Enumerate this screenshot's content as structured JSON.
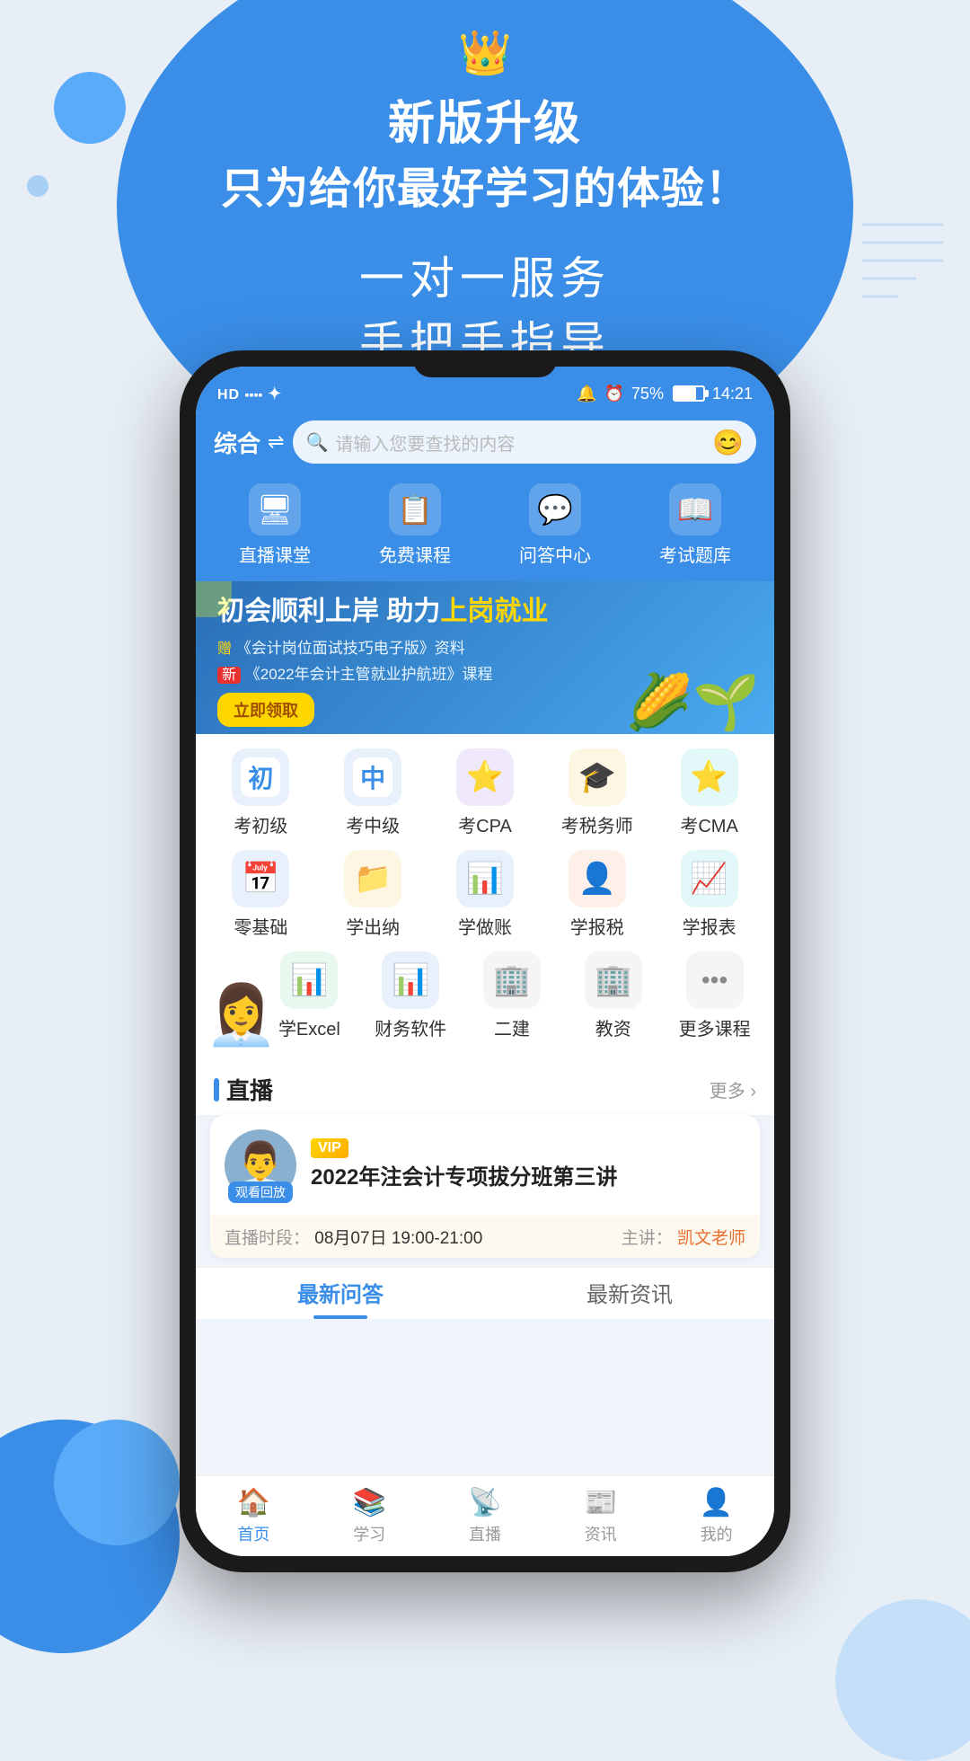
{
  "promo": {
    "crown": "👑",
    "title1": "新版升级",
    "title2": "只为给你最好学习的体验！",
    "subtitle1": "一对一服务",
    "subtitle2": "手把手指导"
  },
  "phone": {
    "status": {
      "left": "HD  ull  ✓",
      "battery_percent": "75%",
      "time": "14:21"
    },
    "header": {
      "category": "综合",
      "filter_icon": "☰",
      "search_placeholder": "请输入您要查找的内容",
      "emoji": "😊"
    },
    "quick_nav": [
      {
        "icon": "🖥",
        "label": "直播课堂"
      },
      {
        "icon": "📋",
        "label": "免费课程"
      },
      {
        "icon": "💬",
        "label": "问答中心"
      },
      {
        "icon": "📖",
        "label": "考试题库"
      }
    ],
    "banner": {
      "title": "初会顺利上岸 助力上岗就业",
      "highlight": "上岗就业",
      "sub1": "赠《会计岗位面试技巧电子版》资料",
      "sub2": "新《2022年会计主管就业护航班》课程",
      "btn": "立即领取"
    },
    "course_rows": [
      [
        {
          "icon": "🎒",
          "label": "考初级",
          "color": "ci-blue"
        },
        {
          "icon": "🎒",
          "label": "考中级",
          "color": "ci-blue"
        },
        {
          "icon": "⭐",
          "label": "考CPA",
          "color": "ci-purple"
        },
        {
          "icon": "🎓",
          "label": "考税务师",
          "color": "ci-yellow"
        },
        {
          "icon": "⭐",
          "label": "考CMA",
          "color": "ci-teal"
        }
      ],
      [
        {
          "icon": "📅",
          "label": "零基础",
          "color": "ci-blue"
        },
        {
          "icon": "📁",
          "label": "学出纳",
          "color": "ci-yellow"
        },
        {
          "icon": "📊",
          "label": "学做账",
          "color": "ci-blue"
        },
        {
          "icon": "👤",
          "label": "学报税",
          "color": "ci-orange"
        },
        {
          "icon": "📈",
          "label": "学报表",
          "color": "ci-teal"
        }
      ],
      [
        {
          "icon": "📊",
          "label": "学Excel",
          "color": "ci-green"
        },
        {
          "icon": "📊",
          "label": "财务软件",
          "color": "ci-blue"
        },
        {
          "icon": "🏢",
          "label": "二建",
          "color": "ci-gray"
        },
        {
          "icon": "🏢",
          "label": "教资",
          "color": "ci-gray"
        },
        {
          "icon": "···",
          "label": "更多课程",
          "color": "ci-gray"
        }
      ]
    ],
    "live_section": {
      "title": "直播",
      "more": "更多 ›",
      "card": {
        "avatar_icon": "👨‍💼",
        "avatar_badge": "观看回放",
        "vip_label": "VIP",
        "title": "2022年注会计专项拔分班第三讲",
        "time_label": "直播时段：",
        "time": "08月07日 19:00-21:00",
        "teacher_label": "主讲：",
        "teacher": "凯文老师"
      }
    },
    "tabs": [
      {
        "label": "最新问答",
        "active": true
      },
      {
        "label": "最新资讯",
        "active": false
      }
    ],
    "bottom_nav": [
      {
        "icon": "🏠",
        "label": "首页",
        "active": true
      },
      {
        "icon": "📚",
        "label": "学习",
        "active": false
      },
      {
        "icon": "📡",
        "label": "直播",
        "active": false
      },
      {
        "icon": "📰",
        "label": "资讯",
        "active": false
      },
      {
        "icon": "👤",
        "label": "我的",
        "active": false
      }
    ]
  }
}
